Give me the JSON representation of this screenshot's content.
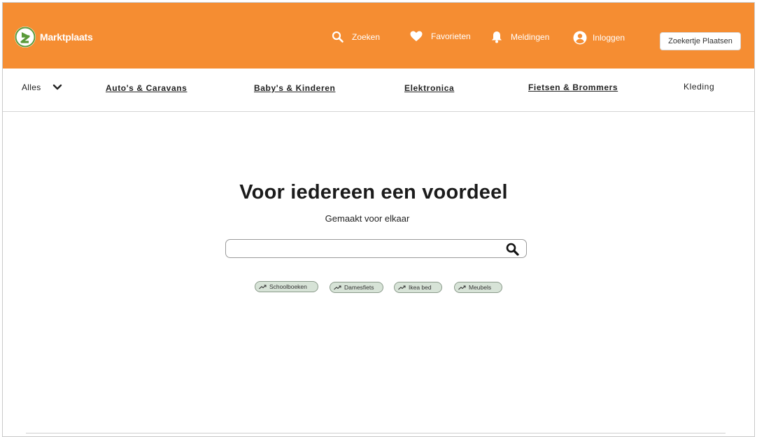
{
  "header": {
    "brand": "Marktplaats",
    "actions": [
      {
        "label": "Zoeken",
        "icon": "search-icon"
      },
      {
        "label": "Favorieten",
        "icon": "heart-icon"
      },
      {
        "label": "Meldingen",
        "icon": "bell-icon"
      },
      {
        "label": "Inloggen",
        "icon": "user-icon"
      }
    ],
    "place_button": "Zoekertje Plaatsen",
    "colors": {
      "bg": "#f58d32",
      "logo_green": "#5a9a3a"
    }
  },
  "categories": {
    "all": "Alles",
    "items": [
      "Auto's & Caravans",
      "Baby's & Kinderen",
      "Elektronica",
      "Fietsen & Brommers",
      "Kleding"
    ]
  },
  "hero": {
    "title": "Voor iedereen een voordeel",
    "subtitle": "Gemaakt voor elkaar"
  },
  "search": {
    "value": "",
    "placeholder": ""
  },
  "trending": [
    {
      "label": "Schoolboeken",
      "icon": "trending-up-icon"
    },
    {
      "label": "Damesfiets",
      "icon": "trending-up-icon"
    },
    {
      "label": "Ikea bed",
      "icon": "trending-up-icon"
    },
    {
      "label": "Meubels",
      "icon": "trending-up-icon"
    }
  ]
}
